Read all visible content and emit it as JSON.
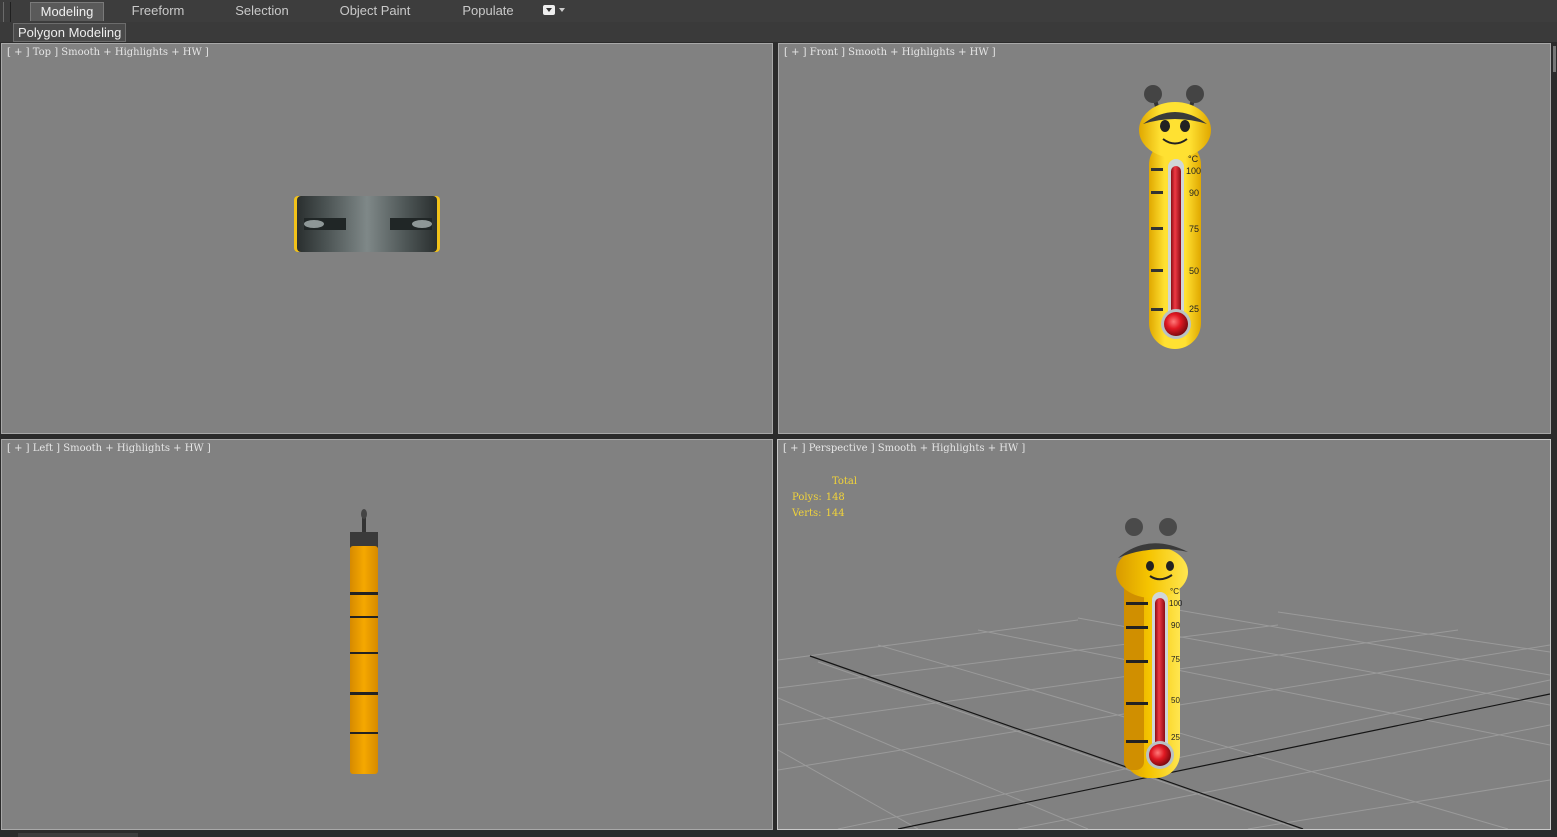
{
  "ribbon": {
    "tabs": [
      {
        "label": "Modeling",
        "active": true
      },
      {
        "label": "Freeform",
        "active": false
      },
      {
        "label": "Selection",
        "active": false
      },
      {
        "label": "Object Paint",
        "active": false
      },
      {
        "label": "Populate",
        "active": false
      }
    ],
    "dropdown_icon": "ribbon-options-icon"
  },
  "subbar": {
    "label": "Polygon Modeling"
  },
  "viewports": {
    "top": {
      "label": "[ + ] Top ] Smooth + Highlights + HW ]"
    },
    "front": {
      "label": "[ + ] Front ] Smooth + Highlights + HW ]"
    },
    "left": {
      "label": "[ + ] Left ] Smooth + Highlights + HW ]"
    },
    "perspective": {
      "label": "[ + ] Perspective ] Smooth + Highlights + HW ]"
    }
  },
  "stats": {
    "title": "Total",
    "polys_label": "Polys:",
    "polys_value": "148",
    "verts_label": "Verts:",
    "verts_value": "144"
  },
  "thermometer": {
    "unit": "°C",
    "ticks": [
      "100",
      "90",
      "75",
      "50",
      "25"
    ]
  },
  "colors": {
    "viewport_bg": "#818181",
    "stats_text": "#f1d33a",
    "body_yellow": "#f7d21c",
    "mercury_red": "#d8202a"
  }
}
